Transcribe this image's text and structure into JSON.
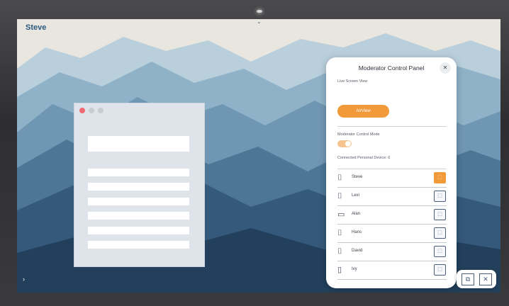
{
  "screen": {
    "user_label": "Steve",
    "top_chevron_icon": "chevron-down-icon",
    "side_arrow_icon": "chevron-right-icon"
  },
  "panel": {
    "title": "Moderator Control Panel",
    "close_icon": "close-icon",
    "close_glyph": "✕",
    "live_screen_label": "Live Screen View",
    "airview_button": "AirView",
    "moderator_mode_label": "Moderator Control Mode",
    "moderator_mode_on": true,
    "connected_label": "Connected Personal Device: 6",
    "devices": [
      {
        "name": "Steve",
        "icon": "laptop-icon",
        "casting": true
      },
      {
        "name": "Lexi",
        "icon": "laptop-icon",
        "casting": false
      },
      {
        "name": "Alan",
        "icon": "tablet-icon",
        "casting": false
      },
      {
        "name": "Hans",
        "icon": "laptop-icon",
        "casting": false
      },
      {
        "name": "David",
        "icon": "laptop-icon",
        "casting": false
      },
      {
        "name": "Ivy",
        "icon": "phone-icon",
        "casting": false
      }
    ]
  },
  "tools": {
    "screen_share_icon": "screen-share-icon",
    "close_share_icon": "close-share-icon"
  },
  "colors": {
    "accent": "#f29a3a",
    "sky": "#e8e6df",
    "mountain_dark": "#2b4c69"
  }
}
